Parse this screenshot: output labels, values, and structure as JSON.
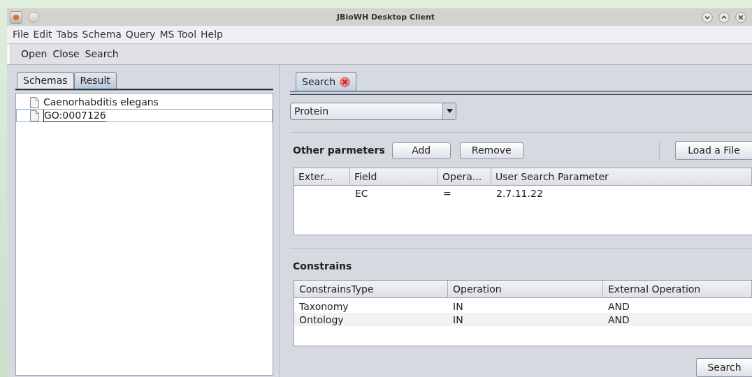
{
  "window": {
    "title": "JBioWH Desktop Client"
  },
  "menu": [
    "File",
    "Edit",
    "Tabs",
    "Schema",
    "Query",
    "MS Tool",
    "Help"
  ],
  "toolbar": [
    "Open",
    "Close",
    "Search"
  ],
  "left_tabs": [
    {
      "label": "Schemas",
      "selected": false
    },
    {
      "label": "Result",
      "selected": true
    }
  ],
  "tree": [
    {
      "label": "Caenorhabditis elegans",
      "selected": false
    },
    {
      "label": "GO:0007126",
      "selected": true
    }
  ],
  "right_tabs": [
    {
      "label": "Search",
      "selected": true
    }
  ],
  "type_select": {
    "value": "Protein"
  },
  "parameters": {
    "title": "Other parmeters",
    "buttons": [
      "Add",
      "Remove"
    ],
    "load_button": "Load a File",
    "columns": [
      "Exter...",
      "Field",
      "Opera...",
      "User Search Parameter"
    ],
    "rows": [
      [
        "",
        "EC",
        "=",
        "2.7.11.22"
      ]
    ]
  },
  "constrains": {
    "title": "Constrains",
    "columns": [
      "ConstrainsType",
      "Operation",
      "External Operation"
    ],
    "rows": [
      [
        "Taxonomy",
        "IN",
        "AND"
      ],
      [
        "Ontology",
        "IN",
        "AND"
      ]
    ]
  },
  "search_button": "Search"
}
